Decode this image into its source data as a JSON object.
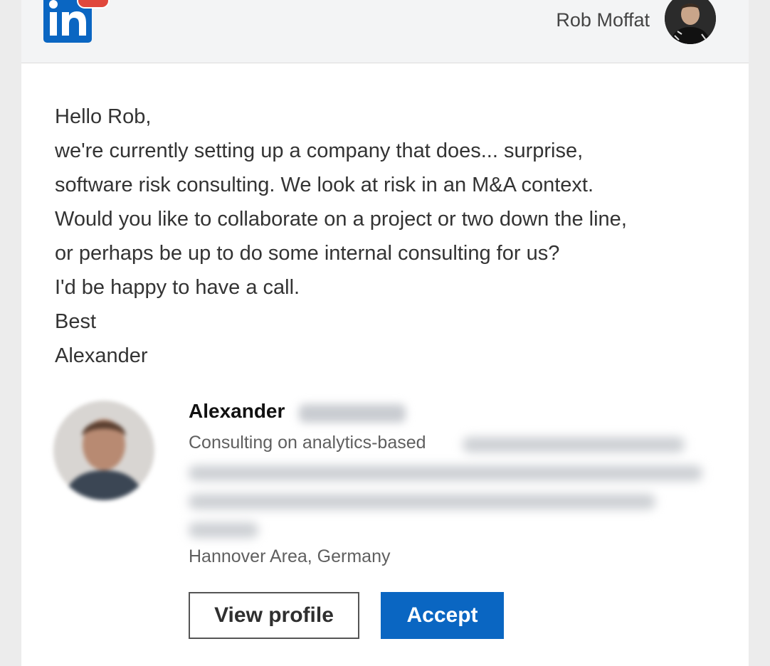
{
  "header": {
    "logo_text": "in",
    "badge_count": "",
    "user_name": "Rob Moffat"
  },
  "message": {
    "lines": [
      "Hello Rob,",
      "we're currently setting up a company that does... surprise,",
      "software risk consulting. We look at risk in an M&A context.",
      "Would you like to collaborate on a project or two down the line,",
      "or perhaps be up to do some internal consulting for us?",
      "I'd be happy to have a call.",
      "Best",
      "Alexander"
    ]
  },
  "profile": {
    "first_name": "Alexander",
    "headline_visible": "Consulting on analytics-based",
    "location": "Hannover Area, Germany"
  },
  "actions": {
    "view_profile_label": "View profile",
    "accept_label": "Accept"
  },
  "colors": {
    "brand_blue": "#0a66c2",
    "badge_red": "#e0473c"
  }
}
